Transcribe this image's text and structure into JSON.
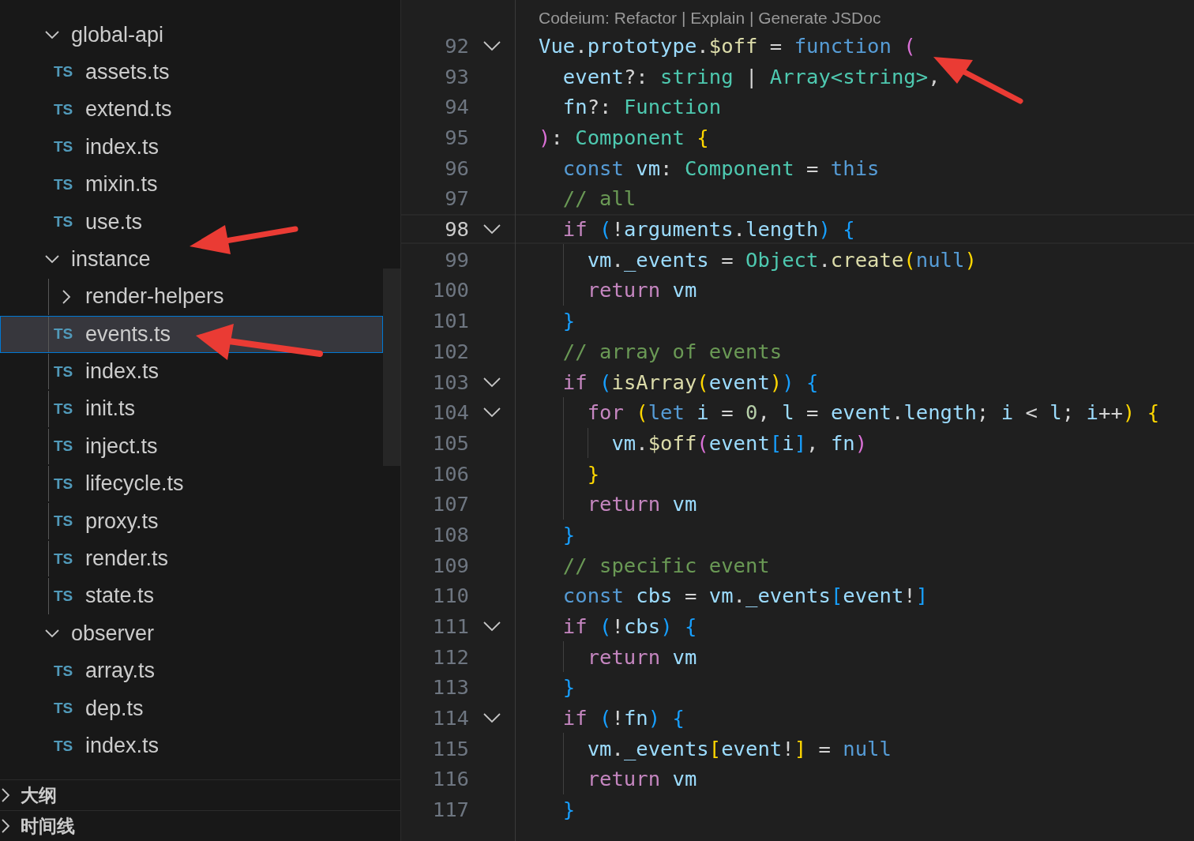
{
  "explorer": {
    "tree": [
      {
        "label": "global-api",
        "kind": "folder",
        "expanded": true,
        "children": [
          {
            "label": "assets.ts",
            "kind": "file",
            "badge": "TS",
            "selected": false
          },
          {
            "label": "extend.ts",
            "kind": "file",
            "badge": "TS",
            "selected": false
          },
          {
            "label": "index.ts",
            "kind": "file",
            "badge": "TS",
            "selected": false
          },
          {
            "label": "mixin.ts",
            "kind": "file",
            "badge": "TS",
            "selected": false
          },
          {
            "label": "use.ts",
            "kind": "file",
            "badge": "TS",
            "selected": false
          }
        ]
      },
      {
        "label": "instance",
        "kind": "folder",
        "expanded": true,
        "children": [
          {
            "label": "render-helpers",
            "kind": "folder",
            "expanded": false
          },
          {
            "label": "events.ts",
            "kind": "file",
            "badge": "TS",
            "selected": true
          },
          {
            "label": "index.ts",
            "kind": "file",
            "badge": "TS",
            "selected": false
          },
          {
            "label": "init.ts",
            "kind": "file",
            "badge": "TS",
            "selected": false
          },
          {
            "label": "inject.ts",
            "kind": "file",
            "badge": "TS",
            "selected": false
          },
          {
            "label": "lifecycle.ts",
            "kind": "file",
            "badge": "TS",
            "selected": false
          },
          {
            "label": "proxy.ts",
            "kind": "file",
            "badge": "TS",
            "selected": false
          },
          {
            "label": "render.ts",
            "kind": "file",
            "badge": "TS",
            "selected": false
          },
          {
            "label": "state.ts",
            "kind": "file",
            "badge": "TS",
            "selected": false
          }
        ]
      },
      {
        "label": "observer",
        "kind": "folder",
        "expanded": true,
        "children": [
          {
            "label": "array.ts",
            "kind": "file",
            "badge": "TS",
            "selected": false
          },
          {
            "label": "dep.ts",
            "kind": "file",
            "badge": "TS",
            "selected": false
          },
          {
            "label": "index.ts",
            "kind": "file",
            "badge": "TS",
            "selected": false
          }
        ]
      }
    ],
    "panels": [
      {
        "label": "大纲",
        "expanded": false
      },
      {
        "label": "时间线",
        "expanded": false
      }
    ]
  },
  "editor": {
    "codelens": "Codeium: Refactor | Explain | Generate JSDoc",
    "lines": [
      {
        "number": "92",
        "foldable": true,
        "current": false,
        "tokens": [
          {
            "kind": "var",
            "text": "Vue"
          },
          {
            "kind": "plain",
            "text": "."
          },
          {
            "kind": "var",
            "text": "prototype"
          },
          {
            "kind": "plain",
            "text": "."
          },
          {
            "kind": "fn",
            "text": "$off"
          },
          {
            "kind": "plain",
            "text": " = "
          },
          {
            "kind": "keyword",
            "text": "function"
          },
          {
            "kind": "bracket2",
            "text": " ("
          }
        ]
      },
      {
        "number": "93",
        "foldable": false,
        "current": false,
        "tokens": [
          {
            "kind": "var",
            "text": "  event"
          },
          {
            "kind": "plain",
            "text": "?: "
          },
          {
            "kind": "type",
            "text": "string"
          },
          {
            "kind": "plain",
            "text": " | "
          },
          {
            "kind": "type",
            "text": "Array<string>"
          },
          {
            "kind": "plain",
            "text": ","
          }
        ]
      },
      {
        "number": "94",
        "foldable": false,
        "current": false,
        "tokens": [
          {
            "kind": "var",
            "text": "  fn"
          },
          {
            "kind": "plain",
            "text": "?: "
          },
          {
            "kind": "type",
            "text": "Function"
          }
        ]
      },
      {
        "number": "95",
        "foldable": false,
        "current": false,
        "tokens": [
          {
            "kind": "bracket2",
            "text": ")"
          },
          {
            "kind": "plain",
            "text": ": "
          },
          {
            "kind": "type",
            "text": "Component"
          },
          {
            "kind": "bracket1",
            "text": " {"
          }
        ]
      },
      {
        "number": "96",
        "foldable": false,
        "current": false,
        "tokens": [
          {
            "kind": "keyword",
            "text": "  const"
          },
          {
            "kind": "var",
            "text": " vm"
          },
          {
            "kind": "plain",
            "text": ": "
          },
          {
            "kind": "type",
            "text": "Component"
          },
          {
            "kind": "plain",
            "text": " = "
          },
          {
            "kind": "keyword",
            "text": "this"
          }
        ]
      },
      {
        "number": "97",
        "foldable": false,
        "current": false,
        "tokens": [
          {
            "kind": "comment",
            "text": "  // all"
          }
        ]
      },
      {
        "number": "98",
        "foldable": true,
        "current": true,
        "tokens": [
          {
            "kind": "control",
            "text": "  if"
          },
          {
            "kind": "bracket3",
            "text": " ("
          },
          {
            "kind": "plain",
            "text": "!"
          },
          {
            "kind": "var",
            "text": "arguments"
          },
          {
            "kind": "plain",
            "text": "."
          },
          {
            "kind": "var",
            "text": "length"
          },
          {
            "kind": "bracket3",
            "text": ")"
          },
          {
            "kind": "bracket3",
            "text": " {"
          }
        ]
      },
      {
        "number": "99",
        "foldable": false,
        "current": false,
        "tokens": [
          {
            "kind": "var",
            "text": "    vm"
          },
          {
            "kind": "plain",
            "text": "."
          },
          {
            "kind": "var",
            "text": "_events"
          },
          {
            "kind": "plain",
            "text": " = "
          },
          {
            "kind": "type",
            "text": "Object"
          },
          {
            "kind": "plain",
            "text": "."
          },
          {
            "kind": "fn",
            "text": "create"
          },
          {
            "kind": "bracket1",
            "text": "("
          },
          {
            "kind": "keyword",
            "text": "null"
          },
          {
            "kind": "bracket1",
            "text": ")"
          }
        ]
      },
      {
        "number": "100",
        "foldable": false,
        "current": false,
        "tokens": [
          {
            "kind": "control",
            "text": "    return"
          },
          {
            "kind": "var",
            "text": " vm"
          }
        ]
      },
      {
        "number": "101",
        "foldable": false,
        "current": false,
        "tokens": [
          {
            "kind": "bracket3",
            "text": "  }"
          }
        ]
      },
      {
        "number": "102",
        "foldable": false,
        "current": false,
        "tokens": [
          {
            "kind": "comment",
            "text": "  // array of events"
          }
        ]
      },
      {
        "number": "103",
        "foldable": true,
        "current": false,
        "tokens": [
          {
            "kind": "control",
            "text": "  if"
          },
          {
            "kind": "bracket3",
            "text": " ("
          },
          {
            "kind": "fn",
            "text": "isArray"
          },
          {
            "kind": "bracket1",
            "text": "("
          },
          {
            "kind": "var",
            "text": "event"
          },
          {
            "kind": "bracket1",
            "text": ")"
          },
          {
            "kind": "bracket3",
            "text": ")"
          },
          {
            "kind": "bracket3",
            "text": " {"
          }
        ]
      },
      {
        "number": "104",
        "foldable": true,
        "current": false,
        "tokens": [
          {
            "kind": "control",
            "text": "    for"
          },
          {
            "kind": "bracket1",
            "text": " ("
          },
          {
            "kind": "keyword",
            "text": "let"
          },
          {
            "kind": "var",
            "text": " i"
          },
          {
            "kind": "plain",
            "text": " = "
          },
          {
            "kind": "number",
            "text": "0"
          },
          {
            "kind": "plain",
            "text": ", "
          },
          {
            "kind": "var",
            "text": "l"
          },
          {
            "kind": "plain",
            "text": " = "
          },
          {
            "kind": "var",
            "text": "event"
          },
          {
            "kind": "plain",
            "text": "."
          },
          {
            "kind": "var",
            "text": "length"
          },
          {
            "kind": "plain",
            "text": "; "
          },
          {
            "kind": "var",
            "text": "i"
          },
          {
            "kind": "plain",
            "text": " < "
          },
          {
            "kind": "var",
            "text": "l"
          },
          {
            "kind": "plain",
            "text": "; "
          },
          {
            "kind": "var",
            "text": "i"
          },
          {
            "kind": "plain",
            "text": "++"
          },
          {
            "kind": "bracket1",
            "text": ")"
          },
          {
            "kind": "bracket1",
            "text": " {"
          }
        ]
      },
      {
        "number": "105",
        "foldable": false,
        "current": false,
        "tokens": [
          {
            "kind": "var",
            "text": "      vm"
          },
          {
            "kind": "plain",
            "text": "."
          },
          {
            "kind": "fn",
            "text": "$off"
          },
          {
            "kind": "bracket2",
            "text": "("
          },
          {
            "kind": "var",
            "text": "event"
          },
          {
            "kind": "bracket3",
            "text": "["
          },
          {
            "kind": "var",
            "text": "i"
          },
          {
            "kind": "bracket3",
            "text": "]"
          },
          {
            "kind": "plain",
            "text": ", "
          },
          {
            "kind": "var",
            "text": "fn"
          },
          {
            "kind": "bracket2",
            "text": ")"
          }
        ]
      },
      {
        "number": "106",
        "foldable": false,
        "current": false,
        "tokens": [
          {
            "kind": "bracket1",
            "text": "    }"
          }
        ]
      },
      {
        "number": "107",
        "foldable": false,
        "current": false,
        "tokens": [
          {
            "kind": "control",
            "text": "    return"
          },
          {
            "kind": "var",
            "text": " vm"
          }
        ]
      },
      {
        "number": "108",
        "foldable": false,
        "current": false,
        "tokens": [
          {
            "kind": "bracket3",
            "text": "  }"
          }
        ]
      },
      {
        "number": "109",
        "foldable": false,
        "current": false,
        "tokens": [
          {
            "kind": "comment",
            "text": "  // specific event"
          }
        ]
      },
      {
        "number": "110",
        "foldable": false,
        "current": false,
        "tokens": [
          {
            "kind": "keyword",
            "text": "  const"
          },
          {
            "kind": "var",
            "text": " cbs"
          },
          {
            "kind": "plain",
            "text": " = "
          },
          {
            "kind": "var",
            "text": "vm"
          },
          {
            "kind": "plain",
            "text": "."
          },
          {
            "kind": "var",
            "text": "_events"
          },
          {
            "kind": "bracket3",
            "text": "["
          },
          {
            "kind": "var",
            "text": "event"
          },
          {
            "kind": "plain",
            "text": "!"
          },
          {
            "kind": "bracket3",
            "text": "]"
          }
        ]
      },
      {
        "number": "111",
        "foldable": true,
        "current": false,
        "tokens": [
          {
            "kind": "control",
            "text": "  if"
          },
          {
            "kind": "bracket3",
            "text": " ("
          },
          {
            "kind": "plain",
            "text": "!"
          },
          {
            "kind": "var",
            "text": "cbs"
          },
          {
            "kind": "bracket3",
            "text": ")"
          },
          {
            "kind": "bracket3",
            "text": " {"
          }
        ]
      },
      {
        "number": "112",
        "foldable": false,
        "current": false,
        "tokens": [
          {
            "kind": "control",
            "text": "    return"
          },
          {
            "kind": "var",
            "text": " vm"
          }
        ]
      },
      {
        "number": "113",
        "foldable": false,
        "current": false,
        "tokens": [
          {
            "kind": "bracket3",
            "text": "  }"
          }
        ]
      },
      {
        "number": "114",
        "foldable": true,
        "current": false,
        "tokens": [
          {
            "kind": "control",
            "text": "  if"
          },
          {
            "kind": "bracket3",
            "text": " ("
          },
          {
            "kind": "plain",
            "text": "!"
          },
          {
            "kind": "var",
            "text": "fn"
          },
          {
            "kind": "bracket3",
            "text": ")"
          },
          {
            "kind": "bracket3",
            "text": " {"
          }
        ]
      },
      {
        "number": "115",
        "foldable": false,
        "current": false,
        "tokens": [
          {
            "kind": "var",
            "text": "    vm"
          },
          {
            "kind": "plain",
            "text": "."
          },
          {
            "kind": "var",
            "text": "_events"
          },
          {
            "kind": "bracket1",
            "text": "["
          },
          {
            "kind": "var",
            "text": "event"
          },
          {
            "kind": "plain",
            "text": "!"
          },
          {
            "kind": "bracket1",
            "text": "]"
          },
          {
            "kind": "plain",
            "text": " = "
          },
          {
            "kind": "keyword",
            "text": "null"
          }
        ]
      },
      {
        "number": "116",
        "foldable": false,
        "current": false,
        "tokens": [
          {
            "kind": "control",
            "text": "    return"
          },
          {
            "kind": "var",
            "text": " vm"
          }
        ]
      },
      {
        "number": "117",
        "foldable": false,
        "current": false,
        "tokens": [
          {
            "kind": "bracket3",
            "text": "  }"
          }
        ]
      }
    ]
  }
}
